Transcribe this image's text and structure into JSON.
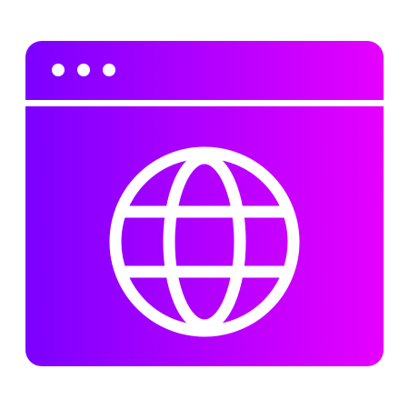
{
  "icon": {
    "name": "browser-window-globe-icon",
    "gradient": {
      "start": "#7b00ff",
      "end": "#e600ff"
    },
    "foreground": "#ffffff",
    "title_bar_dots": 3
  }
}
